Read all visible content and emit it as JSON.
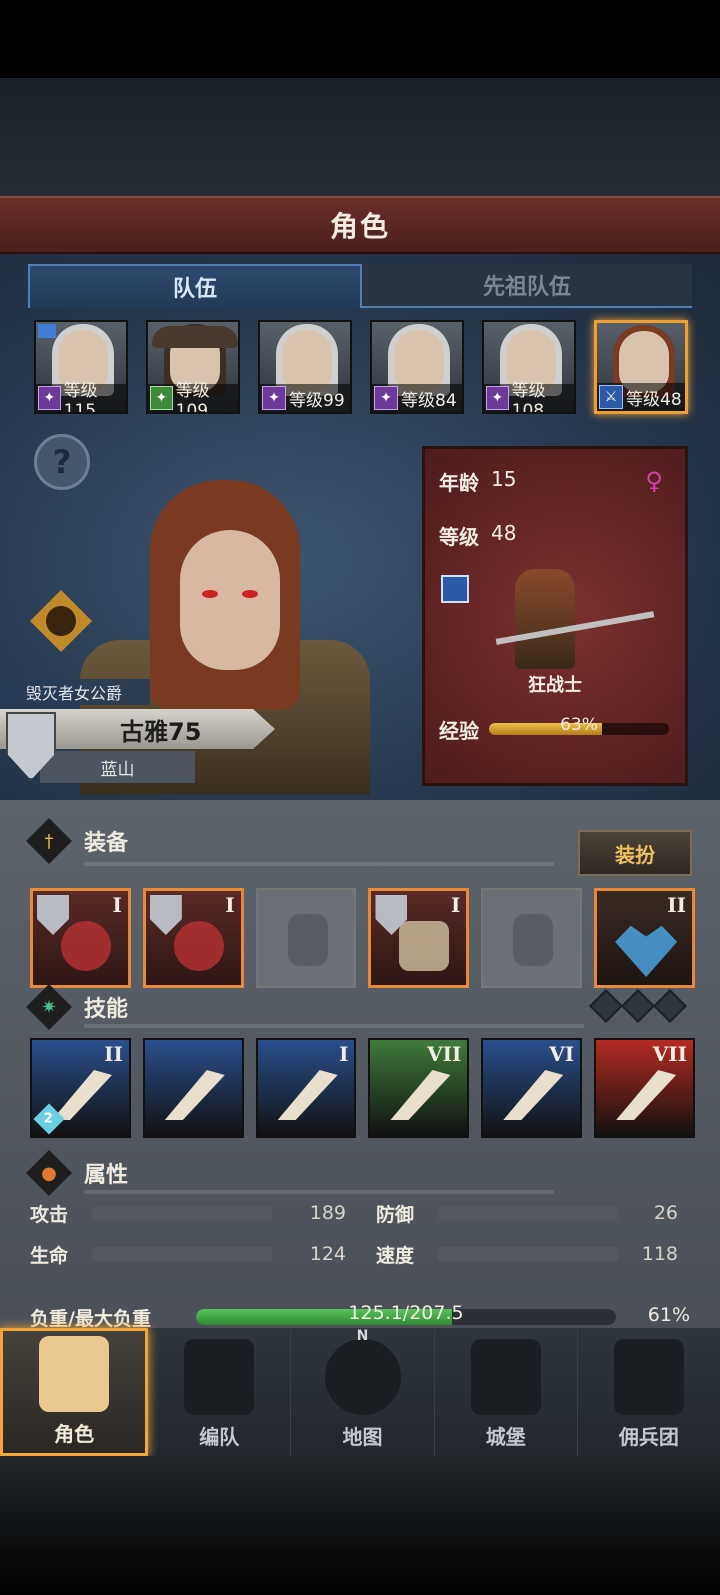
{
  "header": {
    "title": "角色"
  },
  "tabs": [
    {
      "label": "队伍",
      "active": true
    },
    {
      "label": "先祖队伍",
      "active": false
    }
  ],
  "party": [
    {
      "level_text": "等级115",
      "class_icon": "mage-staff-icon",
      "selected": false
    },
    {
      "level_text": "等级109",
      "class_icon": "ranger-bow-icon",
      "selected": false
    },
    {
      "level_text": "等级99",
      "class_icon": "mage-staff-icon",
      "selected": false
    },
    {
      "level_text": "等级84",
      "class_icon": "mage-staff-icon",
      "selected": false
    },
    {
      "level_text": "等级108",
      "class_icon": "mage-staff-icon",
      "selected": false
    },
    {
      "level_text": "等级48",
      "class_icon": "sword-class-icon",
      "selected": true
    }
  ],
  "character": {
    "title": "毁灭者女公爵",
    "name": "古雅75",
    "region": "蓝山",
    "age_label": "年龄",
    "age": "15",
    "level_label": "等级",
    "level": "48",
    "gender_icon": "female-icon",
    "class_name": "狂战士",
    "exp_label": "经验",
    "exp_text": "63%",
    "exp_percent": 63
  },
  "equipment": {
    "label": "装备",
    "dress_button": "装扮",
    "slots": [
      {
        "tier": "I",
        "kind": "weapon",
        "empty": false
      },
      {
        "tier": "I",
        "kind": "weapon",
        "empty": false
      },
      {
        "tier": "",
        "kind": "helmet",
        "empty": true
      },
      {
        "tier": "I",
        "kind": "armor",
        "empty": false
      },
      {
        "tier": "",
        "kind": "boots",
        "empty": true
      },
      {
        "tier": "II",
        "kind": "amulet",
        "empty": false
      }
    ]
  },
  "skills": {
    "label": "技能",
    "items": [
      {
        "tier": "II",
        "color": "#2a4f8c",
        "badge": "2"
      },
      {
        "tier": "",
        "color": "#2a4f8c",
        "badge": ""
      },
      {
        "tier": "I",
        "color": "#2a4f8c",
        "badge": ""
      },
      {
        "tier": "VII",
        "color": "#3e7a3a",
        "badge": ""
      },
      {
        "tier": "VI",
        "color": "#2a4f8c",
        "badge": ""
      },
      {
        "tier": "VII",
        "color": "#b42a22",
        "badge": ""
      }
    ]
  },
  "attributes": {
    "label": "属性",
    "attack_label": "攻击",
    "attack": "189",
    "defense_label": "防御",
    "defense": "26",
    "hp_label": "生命",
    "hp": "124",
    "speed_label": "速度",
    "speed": "118",
    "load_label": "负重/最大负重",
    "load_text": "125.1/207.5",
    "load_percent_text": "61%",
    "load_percent": 61
  },
  "nav": [
    {
      "label": "角色",
      "icon": "knight-icon",
      "active": true
    },
    {
      "label": "编队",
      "icon": "helmet-formation-icon",
      "active": false
    },
    {
      "label": "地图",
      "icon": "compass-map-icon",
      "active": false,
      "north": "N"
    },
    {
      "label": "城堡",
      "icon": "castle-icon",
      "active": false
    },
    {
      "label": "佣兵团",
      "icon": "mercenary-banner-icon",
      "active": false
    }
  ],
  "colors": {
    "accent": "#f0a030",
    "exp_bar": "#e0b040",
    "load_bar": "#4cb04e",
    "title_bar": "#5a2622"
  }
}
